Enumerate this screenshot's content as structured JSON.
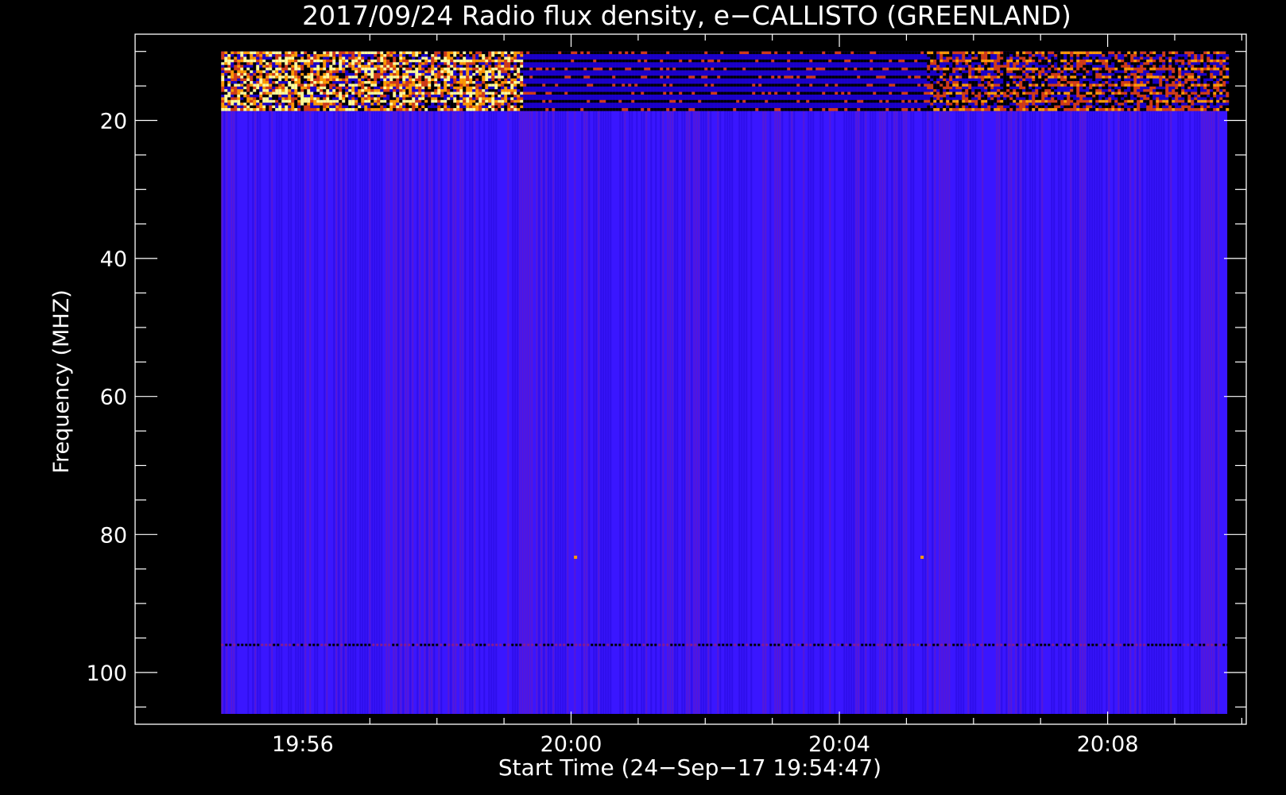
{
  "chart_data": {
    "type": "heatmap",
    "title": "2017/09/24  Radio flux density, e−CALLISTO (GREENLAND)",
    "xlabel": "Start Time (24−Sep−17 19:54:47)",
    "ylabel": "Frequency (MHZ)",
    "x_tick_labels": [
      "19:56",
      "20:00",
      "20:04",
      "20:08"
    ],
    "x_tick_minutes": [
      -3,
      -2,
      -1,
      0,
      1,
      2,
      3,
      4,
      5,
      6,
      7,
      8,
      9,
      10,
      11,
      12,
      13,
      14,
      15,
      16
    ],
    "y_tick_labels": [
      "20",
      "40",
      "60",
      "80",
      "100"
    ],
    "y_tick_values": [
      20,
      40,
      60,
      80,
      100
    ],
    "y_minor_ticks": [
      10,
      15,
      25,
      30,
      35,
      45,
      50,
      55,
      65,
      70,
      75,
      85,
      90,
      95,
      105
    ],
    "xlim": [
      "19:53:30",
      "20:10:04"
    ],
    "ylim": [
      107.5,
      7.5
    ],
    "data_extent": {
      "t_start": "19:54:47",
      "t_end": "20:09:47",
      "f_min": 10,
      "f_max": 106
    },
    "colormap": [
      "#000000",
      "#1a00c8",
      "#3a16ff",
      "#8a1c8c",
      "#d23c14",
      "#ff9a00",
      "#ffff96"
    ],
    "background_level": "#3a16ff",
    "features": [
      {
        "type": "band",
        "f_from": 10,
        "f_to": 18.6,
        "t_from": "19:54:47",
        "t_to": "20:09:47",
        "intensity": "high"
      },
      {
        "type": "dark_line",
        "f": 96.0
      },
      {
        "type": "spot",
        "t": "20:00:04",
        "f": 83.3
      },
      {
        "type": "spot",
        "t": "20:05:14",
        "f": 83.3
      }
    ]
  }
}
